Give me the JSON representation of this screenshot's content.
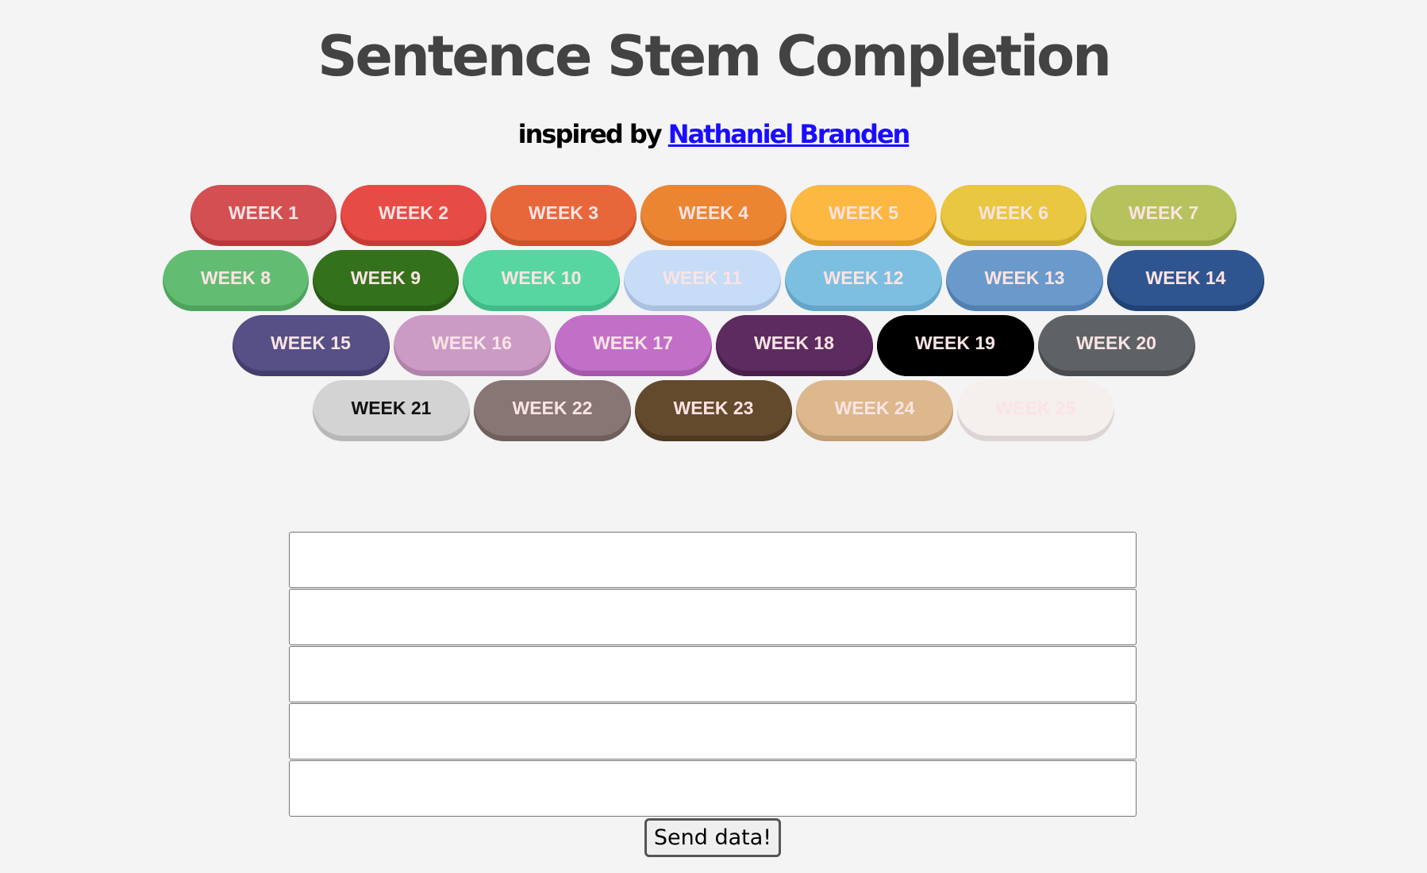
{
  "header": {
    "title": "Sentence Stem Completion",
    "subtitle_prefix": "inspired by",
    "author_link": "Nathaniel Branden"
  },
  "weeks": [
    {
      "label": "WEEK 1",
      "color": "#d34f52",
      "shadow": "#b8393c"
    },
    {
      "label": "WEEK 2",
      "color": "#e74b45",
      "shadow": "#c93a35"
    },
    {
      "label": "WEEK 3",
      "color": "#e8673a",
      "shadow": "#c9532b"
    },
    {
      "label": "WEEK 4",
      "color": "#ec8532",
      "shadow": "#cf6f24"
    },
    {
      "label": "WEEK 5",
      "color": "#fcb840",
      "shadow": "#dd9d2a"
    },
    {
      "label": "WEEK 6",
      "color": "#e9c740",
      "shadow": "#ccab2c"
    },
    {
      "label": "WEEK 7",
      "color": "#b6c25c",
      "shadow": "#9aa745"
    },
    {
      "label": "WEEK 8",
      "color": "#62bd72",
      "shadow": "#4ea35d"
    },
    {
      "label": "WEEK 9",
      "color": "#34711b",
      "shadow": "#275a13"
    },
    {
      "label": "WEEK 10",
      "color": "#58d6a2",
      "shadow": "#43bb89"
    },
    {
      "label": "WEEK 11",
      "color": "#c6dcf7",
      "shadow": "#a9c1df"
    },
    {
      "label": "WEEK 12",
      "color": "#7dbfe1",
      "shadow": "#64a5c8"
    },
    {
      "label": "WEEK 13",
      "color": "#6a99cb",
      "shadow": "#537fb1"
    },
    {
      "label": "WEEK 14",
      "color": "#2f5591",
      "shadow": "#214276"
    },
    {
      "label": "WEEK 15",
      "color": "#565086",
      "shadow": "#433e6e"
    },
    {
      "label": "WEEK 16",
      "color": "#cb9bc6",
      "shadow": "#b183ac"
    },
    {
      "label": "WEEK 17",
      "color": "#c26fc8",
      "shadow": "#a658ad"
    },
    {
      "label": "WEEK 18",
      "color": "#5d2b60",
      "shadow": "#48204b"
    },
    {
      "label": "WEEK 19",
      "color": "#000000",
      "shadow": "#000000"
    },
    {
      "label": "WEEK 20",
      "color": "#5e6266",
      "shadow": "#4a4d50"
    },
    {
      "label": "WEEK 21",
      "color": "#d3d3d3",
      "shadow": "#b8b8b8",
      "text": "#111111"
    },
    {
      "label": "WEEK 22",
      "color": "#877674",
      "shadow": "#6f605e"
    },
    {
      "label": "WEEK 23",
      "color": "#644a2d",
      "shadow": "#4f3922"
    },
    {
      "label": "WEEK 24",
      "color": "#dcb88c",
      "shadow": "#c29f74"
    },
    {
      "label": "WEEK 25",
      "color": "#f5efee",
      "shadow": "#dcd5d4"
    }
  ],
  "form": {
    "fields": [
      "",
      "",
      "",
      "",
      ""
    ],
    "submit_label": "Send data!"
  }
}
